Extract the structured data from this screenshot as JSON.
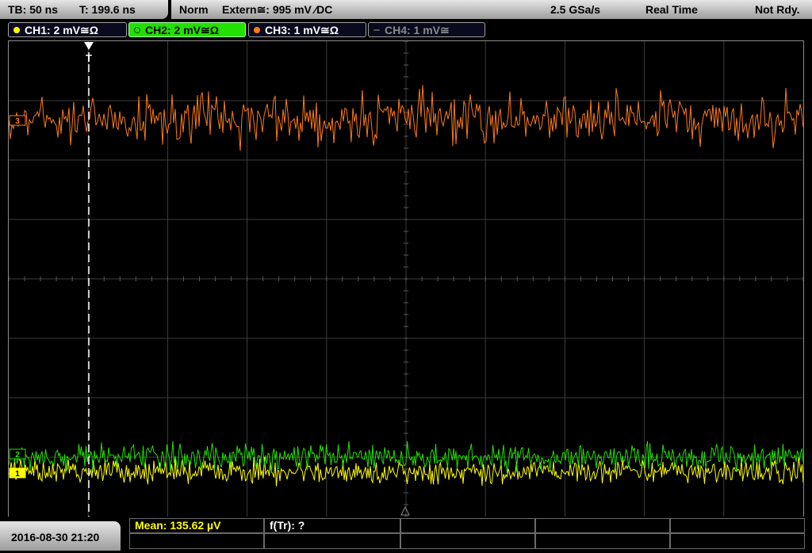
{
  "topbar": {
    "timebase": "TB: 50 ns",
    "trigger_time": "T: 199.6 ns",
    "mode": "Norm",
    "trigger": "Extern≅: 995 mV ⁄DC",
    "sample_rate": "2.5 GSa/s",
    "acq_mode": "Real Time",
    "status": "Not Rdy."
  },
  "channels": [
    {
      "label": "CH1: 2 mV≅Ω",
      "color": "#ffff00",
      "active": false
    },
    {
      "label": "CH2: 2 mV≅Ω",
      "color": "#22e000",
      "active": true
    },
    {
      "label": "CH3: 1 mV≅Ω",
      "color": "#ff7a1a",
      "active": false
    },
    {
      "label": "CH4: 1 mV≅",
      "color": "#6a6a6a",
      "active": false
    }
  ],
  "markers": {
    "trigger": "T",
    "ch3_ref": "3",
    "ch2_ref": "2",
    "ch1_ref": "1"
  },
  "measurements": {
    "mean": "Mean: 135.62 µV",
    "freq": "f(Tr): ?"
  },
  "datetime": "2016-08-30 21:20",
  "colors": {
    "ch1": "#ffff00",
    "ch2": "#22e000",
    "ch3": "#ff7a1a",
    "grid": "#3c3c3c"
  }
}
